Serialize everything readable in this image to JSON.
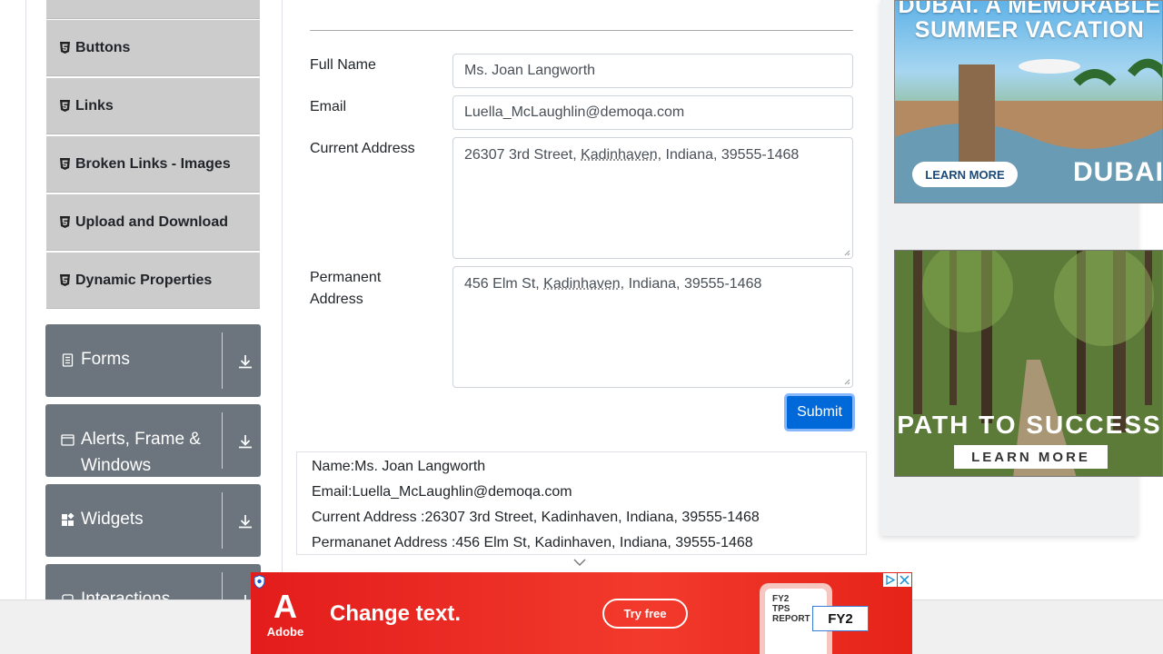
{
  "sidebar": {
    "sub_items": [
      {
        "label": "Buttons"
      },
      {
        "label": "Links"
      },
      {
        "label": "Broken Links - Images"
      },
      {
        "label": "Upload and Download"
      },
      {
        "label": "Dynamic Properties"
      }
    ],
    "groups": [
      {
        "label": "Forms",
        "icon": "document-icon"
      },
      {
        "label": "Alerts, Frame & Windows",
        "icon": "window-icon"
      },
      {
        "label": "Widgets",
        "icon": "widgets-icon"
      },
      {
        "label": "Interactions",
        "icon": "interactions-icon"
      }
    ]
  },
  "form": {
    "fields": [
      {
        "label": "Full Name",
        "value": "Ms. Joan Langworth"
      },
      {
        "label": "Email",
        "value": "Luella_McLaughlin@demoqa.com"
      }
    ],
    "current_address": {
      "label": "Current Address",
      "value_prefix": "26307 3rd Street, ",
      "value_city": "Kadinhaven",
      "value_suffix": ", Indiana, 39555-1468"
    },
    "permanent_address": {
      "label_line1": "Permanent",
      "label_line2": "Address",
      "value_prefix": "456 Elm St, ",
      "value_city": "Kadinhaven",
      "value_suffix": ", Indiana, 39555-1468"
    },
    "submit_label": "Submit"
  },
  "output": {
    "lines": [
      "Name:Ms. Joan Langworth",
      "Email:Luella_McLaughlin@demoqa.com",
      "Current Address :26307 3rd Street, Kadinhaven, Indiana, 39555-1468",
      "Permananet Address :456 Elm St, Kadinhaven, Indiana, 39555-1468"
    ]
  },
  "ads": {
    "dubai": {
      "title_line1": "DUBAI. A MEMORABLE",
      "title_line2": "SUMMER VACATION",
      "button": "LEARN MORE",
      "brand": "DUBAI"
    },
    "path": {
      "title": "PATH TO SUCCESS",
      "button": "LEARN MORE"
    },
    "banner": {
      "logo_letter": "A",
      "logo_word": "Adobe",
      "headline": "Change text.",
      "button": "Try free",
      "phone_line1": "FY2",
      "phone_line2": "TPS",
      "phone_line3": "REPORT",
      "edit_text": "FY2"
    }
  },
  "colors": {
    "sidebar_group": "#6c757d",
    "sidebar_subitem": "#cccccc",
    "submit": "#0069d9",
    "banner": "#e31c1c"
  }
}
